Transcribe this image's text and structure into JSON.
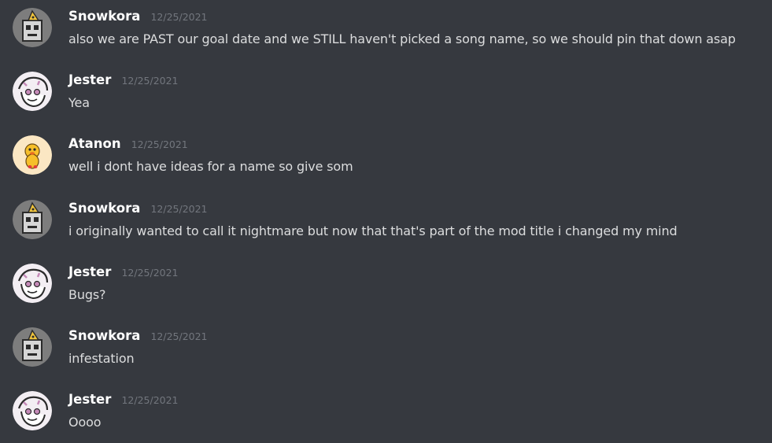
{
  "messages": [
    {
      "author": "Snowkora",
      "avatar_icon": "robot-avatar-icon",
      "timestamp": "12/25/2021",
      "text": "also we are PAST our goal date and we STILL haven't picked a song name, so we should pin that down asap"
    },
    {
      "author": "Jester",
      "avatar_icon": "jester-avatar-icon",
      "timestamp": "12/25/2021",
      "text": "Yea"
    },
    {
      "author": "Atanon",
      "avatar_icon": "duck-avatar-icon",
      "timestamp": "12/25/2021",
      "text": "well i dont have ideas for a name so give som"
    },
    {
      "author": "Snowkora",
      "avatar_icon": "robot-avatar-icon",
      "timestamp": "12/25/2021",
      "text": "i originally wanted to call it nightmare but now that that's part of the mod title i changed my mind"
    },
    {
      "author": "Jester",
      "avatar_icon": "jester-avatar-icon",
      "timestamp": "12/25/2021",
      "text": "Bugs?"
    },
    {
      "author": "Snowkora",
      "avatar_icon": "robot-avatar-icon",
      "timestamp": "12/25/2021",
      "text": "infestation"
    },
    {
      "author": "Jester",
      "avatar_icon": "jester-avatar-icon",
      "timestamp": "12/25/2021",
      "text": "Oooo"
    }
  ],
  "colors": {
    "background": "#36393f",
    "author": "#ffffff",
    "timestamp": "#72767d",
    "message_text": "#dcddde"
  }
}
